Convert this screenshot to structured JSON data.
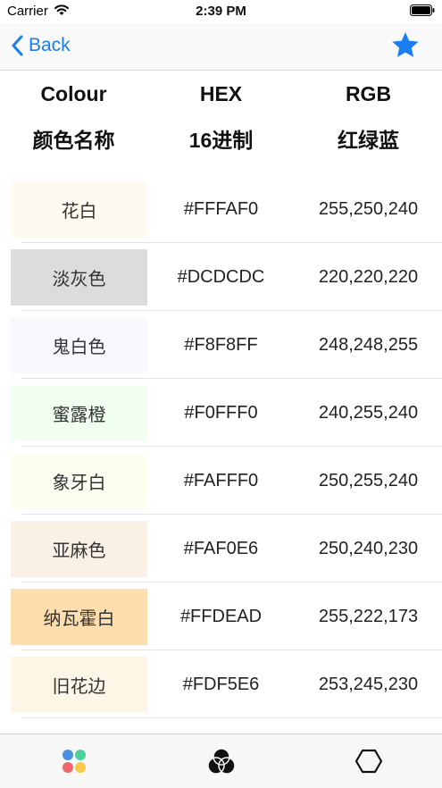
{
  "status": {
    "carrier": "Carrier",
    "time": "2:39 PM"
  },
  "nav": {
    "back_label": "Back"
  },
  "header": {
    "col1_en": "Colour",
    "col1_cn": "颜色名称",
    "col2_en": "HEX",
    "col2_cn": "16进制",
    "col3_en": "RGB",
    "col3_cn": "红绿蓝"
  },
  "colors": [
    {
      "name": "花白",
      "hex": "#FFFAF0",
      "rgb": "255,250,240",
      "swatch": "#FFFAF0"
    },
    {
      "name": "淡灰色",
      "hex": "#DCDCDC",
      "rgb": "220,220,220",
      "swatch": "#DCDCDC"
    },
    {
      "name": "鬼白色",
      "hex": "#F8F8FF",
      "rgb": "248,248,255",
      "swatch": "#F8F8FF"
    },
    {
      "name": "蜜露橙",
      "hex": "#F0FFF0",
      "rgb": "240,255,240",
      "swatch": "#F0FFF0"
    },
    {
      "name": "象牙白",
      "hex": "#FAFFF0",
      "rgb": "250,255,240",
      "swatch": "#FAFFF0"
    },
    {
      "name": "亚麻色",
      "hex": "#FAF0E6",
      "rgb": "250,240,230",
      "swatch": "#FAF0E6"
    },
    {
      "name": "纳瓦霍白",
      "hex": "#FFDEAD",
      "rgb": "255,222,173",
      "swatch": "#FFDEAD"
    },
    {
      "name": "旧花边",
      "hex": "#FDF5E6",
      "rgb": "253,245,230",
      "swatch": "#FDF5E6"
    }
  ],
  "theme": {
    "accent": "#1A7DF0"
  },
  "tabs": [
    {
      "icon": "palette-dots-icon"
    },
    {
      "icon": "rgb-circles-icon"
    },
    {
      "icon": "hexagon-icon"
    }
  ]
}
